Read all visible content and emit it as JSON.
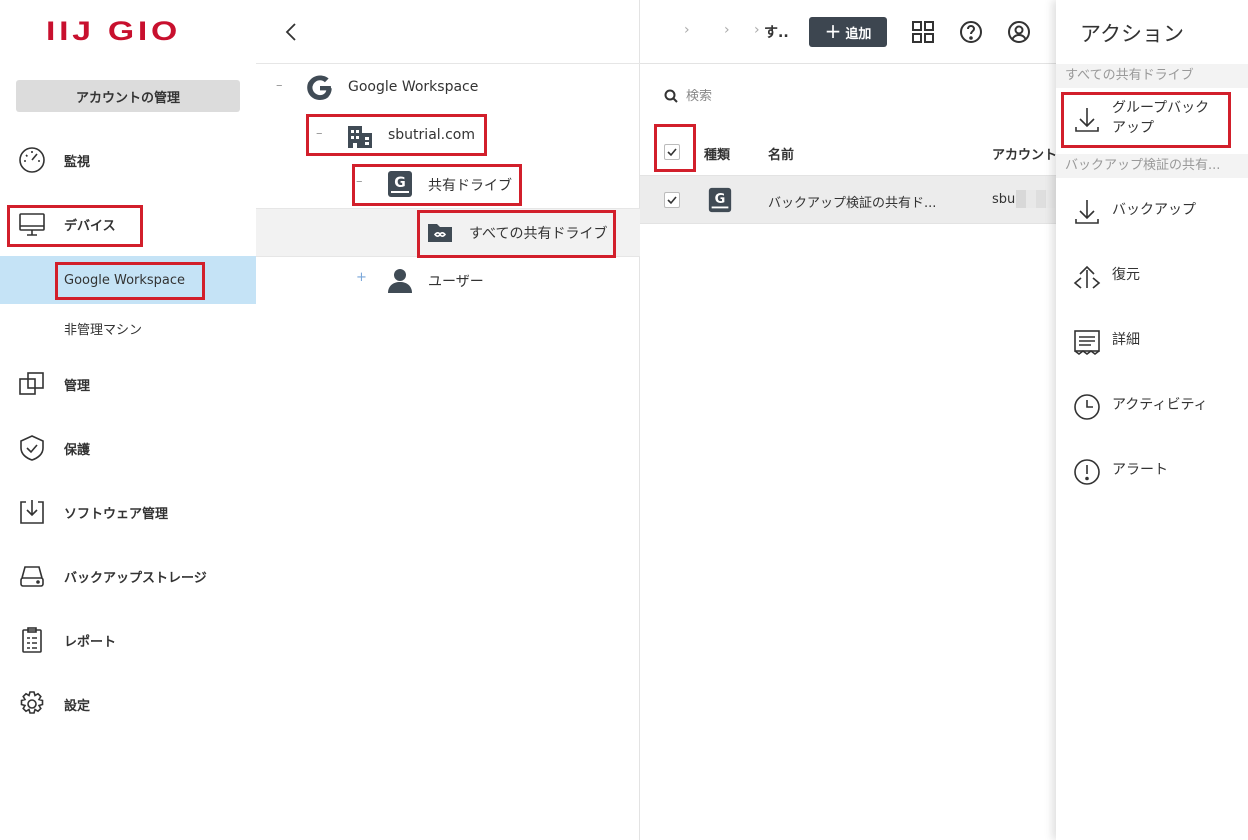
{
  "nav": {
    "logo": "IIJ GIO",
    "account_button": "アカウントの管理",
    "items": [
      {
        "label": "監視",
        "icon": "gauge-icon"
      },
      {
        "label": "デバイス",
        "icon": "monitor-icon"
      },
      {
        "label": "管理",
        "icon": "manage-icon"
      },
      {
        "label": "保護",
        "icon": "shield-icon"
      },
      {
        "label": "ソフトウェア管理",
        "icon": "software-install-icon"
      },
      {
        "label": "バックアップストレージ",
        "icon": "drive-icon"
      },
      {
        "label": "レポート",
        "icon": "clipboard-icon"
      },
      {
        "label": "設定",
        "icon": "gear-icon"
      }
    ],
    "sub_items": [
      {
        "label": "Google Workspace"
      },
      {
        "label": "非管理マシン"
      }
    ]
  },
  "tree": {
    "nodes": [
      {
        "toggle": "–",
        "label": "Google Workspace",
        "icon": "google-g-icon"
      },
      {
        "toggle": "–",
        "label": "sbutrial.com",
        "icon": "building-icon"
      },
      {
        "toggle": "–",
        "label": "共有ドライブ",
        "icon": "shared-drive-icon"
      },
      {
        "toggle": "",
        "label": "すべての共有ドライブ",
        "icon": "shared-folder-icon"
      },
      {
        "toggle": "+",
        "label": "ユーザー",
        "icon": "user-icon"
      }
    ]
  },
  "toolbar": {
    "breadcrumb_sep": "›",
    "breadcrumb_current": "す..",
    "add_label": "追加",
    "add_icon": "plus-icon"
  },
  "search": {
    "placeholder": "検索"
  },
  "table": {
    "headers": {
      "type": "種類",
      "name": "名前",
      "account": "アカウント"
    },
    "rows": [
      {
        "checked": true,
        "type_icon": "shared-drive-icon",
        "name": "バックアップ検証の共有ド...",
        "account": "sbu"
      }
    ]
  },
  "actions": {
    "title": "アクション",
    "section1": "すべての共有ドライブ",
    "group_backup": "グループバック\nアップ",
    "section2": "バックアップ検証の共有...",
    "items": [
      {
        "label": "バックアップ",
        "icon": "download-icon"
      },
      {
        "label": "復元",
        "icon": "restore-icon"
      },
      {
        "label": "詳細",
        "icon": "details-icon"
      },
      {
        "label": "アクティビティ",
        "icon": "clock-icon"
      },
      {
        "label": "アラート",
        "icon": "alert-icon"
      }
    ]
  },
  "colors": {
    "accent_red": "#d21f2b",
    "logo_red": "#c8102e",
    "active_blue": "#c5e3f6",
    "dark_button": "#3d4650"
  }
}
